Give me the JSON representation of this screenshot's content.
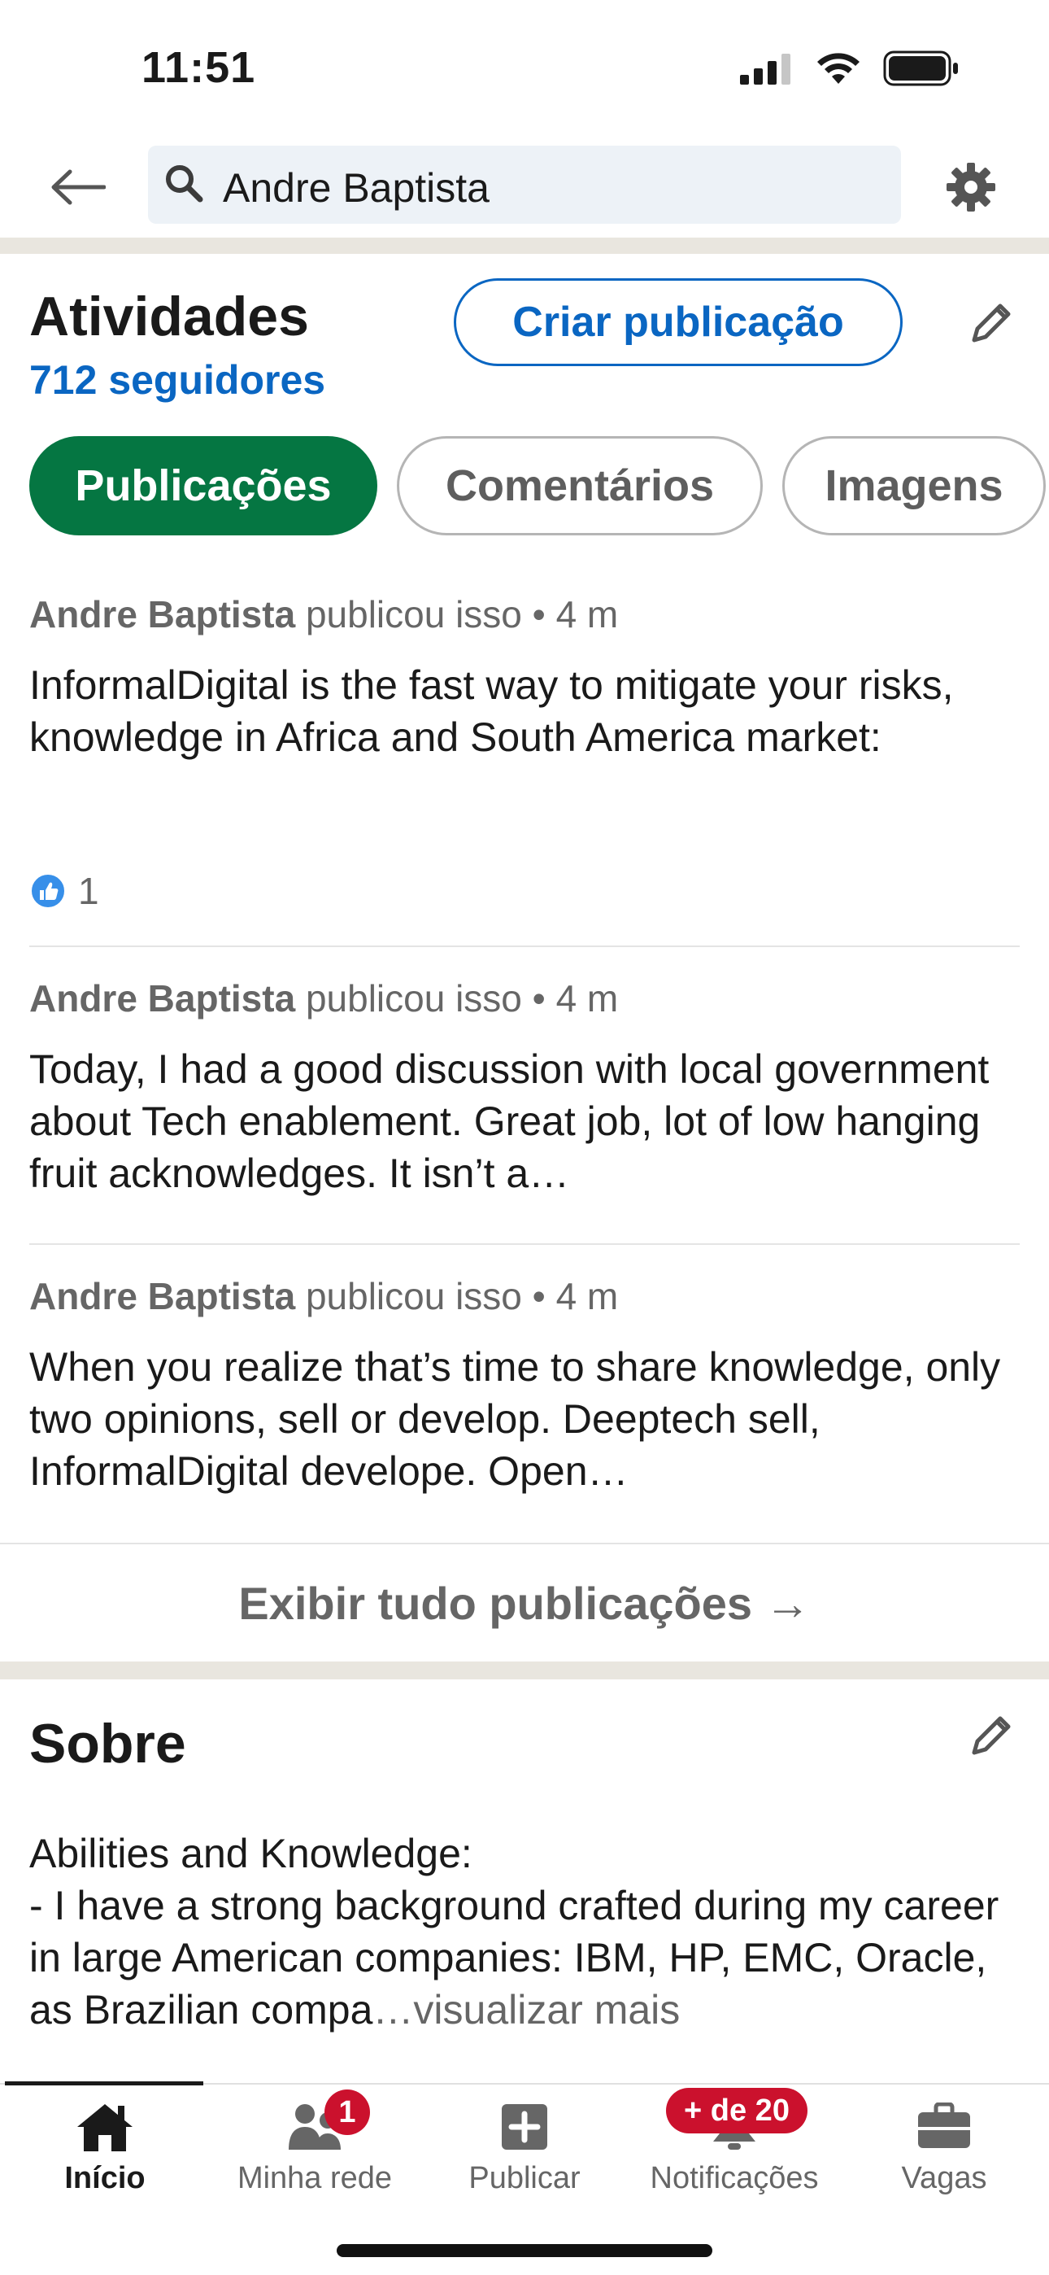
{
  "status_bar": {
    "time": "11:51"
  },
  "header": {
    "search_query": "Andre Baptista"
  },
  "activities": {
    "title": "Atividades",
    "followers": "712 seguidores",
    "create_post": "Criar publicação",
    "tabs": [
      {
        "label": "Publicações",
        "active": true
      },
      {
        "label": "Comentários",
        "active": false
      },
      {
        "label": "Imagens",
        "active": false
      }
    ],
    "posts": [
      {
        "author": "Andre Baptista",
        "action": "publicou isso",
        "time": "4 m",
        "text": "InformalDigital is the fast way to mitigate your risks, knowledge in Africa and South America market:",
        "reactions": "1"
      },
      {
        "author": "Andre Baptista",
        "action": "publicou isso",
        "time": "4 m",
        "text": "Today, I had a good discussion with local government about Tech enablement.  Great job, lot of low hanging fruit acknowledges. It isn’t a…"
      },
      {
        "author": "Andre Baptista",
        "action": "publicou isso",
        "time": "4 m",
        "text": "When you realize that’s time to share knowledge, only two opinions, sell or develop. Deeptech sell, InformalDigital develope. Open…"
      }
    ],
    "show_all": "Exibir tudo publicações →"
  },
  "about": {
    "title": "Sobre",
    "text": "Abilities and Knowledge:\n- I have a strong background crafted during my career in large American companies: IBM, HP, EMC, Oracle, as Brazilian compa",
    "more": "…visualizar mais"
  },
  "bottom_nav": {
    "items": [
      {
        "label": "Início",
        "icon": "home-icon",
        "active": true
      },
      {
        "label": "Minha rede",
        "icon": "network-icon",
        "badge": "1"
      },
      {
        "label": "Publicar",
        "icon": "post-plus-icon"
      },
      {
        "label": "Notificações",
        "icon": "bell-icon",
        "badge": "+ de 20"
      },
      {
        "label": "Vagas",
        "icon": "briefcase-icon"
      }
    ]
  },
  "colors": {
    "brand_blue": "#0a66c2",
    "active_green": "#057642",
    "badge_red": "#cb112d"
  }
}
